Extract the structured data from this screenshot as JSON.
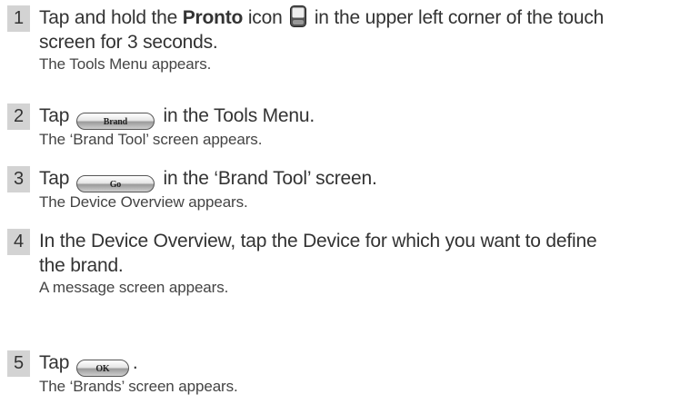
{
  "steps": [
    {
      "number": "1",
      "text_a": "Tap and hold the ",
      "bold": "Pronto",
      "text_b": " icon ",
      "icon": "pronto-device-icon",
      "text_c": " in the upper left corner of the touch",
      "text_d": "screen for 3 seconds.",
      "result": "The Tools Menu appears."
    },
    {
      "number": "2",
      "text_a": "Tap ",
      "button": "Brand",
      "text_b": " in the Tools Menu.",
      "result": "The ‘Brand Tool’ screen appears."
    },
    {
      "number": "3",
      "text_a": "Tap ",
      "button": "Go",
      "text_b": " in the ‘Brand Tool’ screen.",
      "result": "The Device Overview appears."
    },
    {
      "number": "4",
      "text_a": "In the Device Overview, tap the Device for which you want to define",
      "text_b": "the brand.",
      "result": "A message screen appears."
    },
    {
      "number": "5",
      "text_a": "Tap ",
      "button": "OK",
      "text_b": ".",
      "result": "The ‘Brands’ screen appears."
    }
  ]
}
